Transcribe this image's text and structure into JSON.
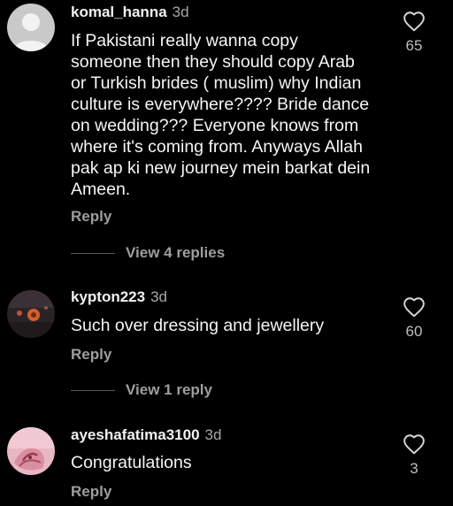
{
  "comments": [
    {
      "username": "komal_hanna",
      "time": "3d",
      "text_lines": [
        "If Pakistani really wanna copy",
        "someone then they should copy Arab",
        "or Turkish brides ( muslim) why Indian",
        "culture is everywhere???? Bride dance",
        "on wedding??? Everyone knows from",
        "where it's coming from. Anyways Allah",
        "pak ap ki new journey mein barkat dein",
        "Ameen."
      ],
      "reply_label": "Reply",
      "likes": "65",
      "view_replies": "View 4 replies",
      "avatar_icon": "default-user-avatar-icon"
    },
    {
      "username": "kypton223",
      "time": "3d",
      "text_lines": [
        "Such over dressing and jewellery"
      ],
      "reply_label": "Reply",
      "likes": "60",
      "view_replies": "View 1 reply",
      "avatar_icon": "flower-photo-avatar"
    },
    {
      "username": "ayeshafatima3100",
      "time": "3d",
      "text_lines": [
        "Congratulations"
      ],
      "reply_label": "Reply",
      "likes": "3",
      "avatar_icon": "hands-photo-avatar"
    }
  ],
  "colors": {
    "background": "#000000",
    "text": "#f5f5f5",
    "muted": "#9e9e9e",
    "line": "#5a5a5a"
  },
  "icons": {
    "like": "heart-outline-icon"
  }
}
